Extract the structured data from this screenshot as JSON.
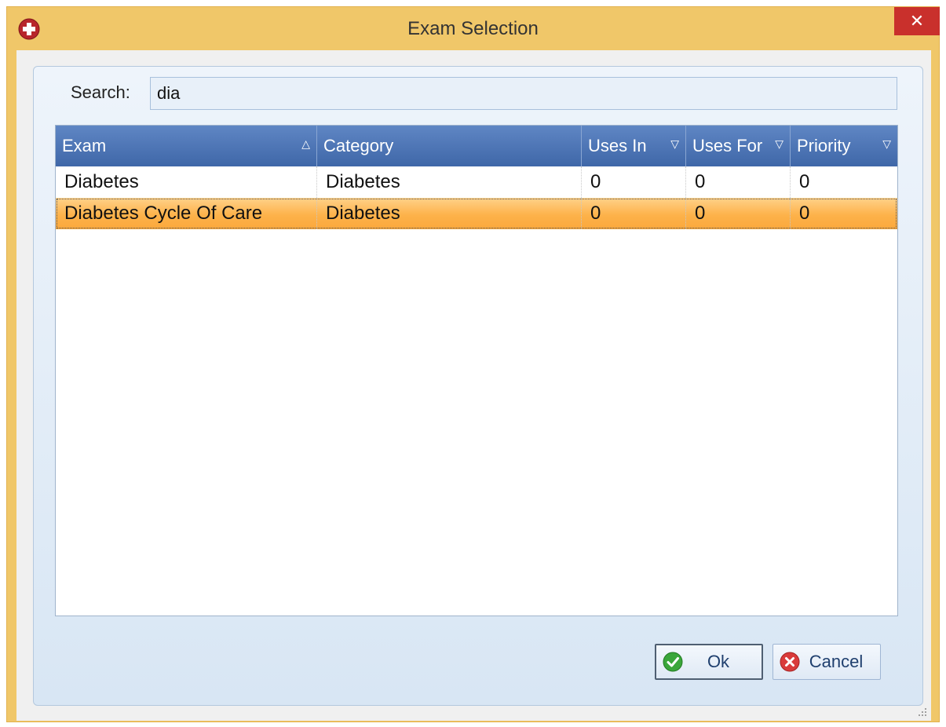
{
  "window": {
    "title": "Exam Selection",
    "close_glyph": "✕",
    "app_icon": "medical-cross-icon"
  },
  "search": {
    "label": "Search:",
    "value": "dia"
  },
  "grid": {
    "columns": [
      {
        "label": "Exam",
        "sort": "ascending",
        "sort_glyph": "△"
      },
      {
        "label": "Category",
        "sort": "",
        "sort_glyph": ""
      },
      {
        "label": "Uses In",
        "sort": "filter",
        "sort_glyph": "▽"
      },
      {
        "label": "Uses For",
        "sort": "filter",
        "sort_glyph": "▽"
      },
      {
        "label": "Priority",
        "sort": "filter",
        "sort_glyph": "▽"
      }
    ],
    "rows": [
      {
        "exam": "Diabetes",
        "category": "Diabetes",
        "uses_in": "0",
        "uses_for": "0",
        "priority": "0",
        "selected": false
      },
      {
        "exam": "Diabetes Cycle Of Care",
        "category": "Diabetes",
        "uses_in": "0",
        "uses_for": "0",
        "priority": "0",
        "selected": true
      }
    ]
  },
  "buttons": {
    "ok_label": "Ok",
    "cancel_label": "Cancel"
  },
  "colors": {
    "title_bar": "#f0c769",
    "close_button": "#c9302c",
    "header": "#4a72b4",
    "selected_row": "#fdb24a",
    "ok_icon": "#3aa63a",
    "cancel_icon": "#d93b3b"
  }
}
